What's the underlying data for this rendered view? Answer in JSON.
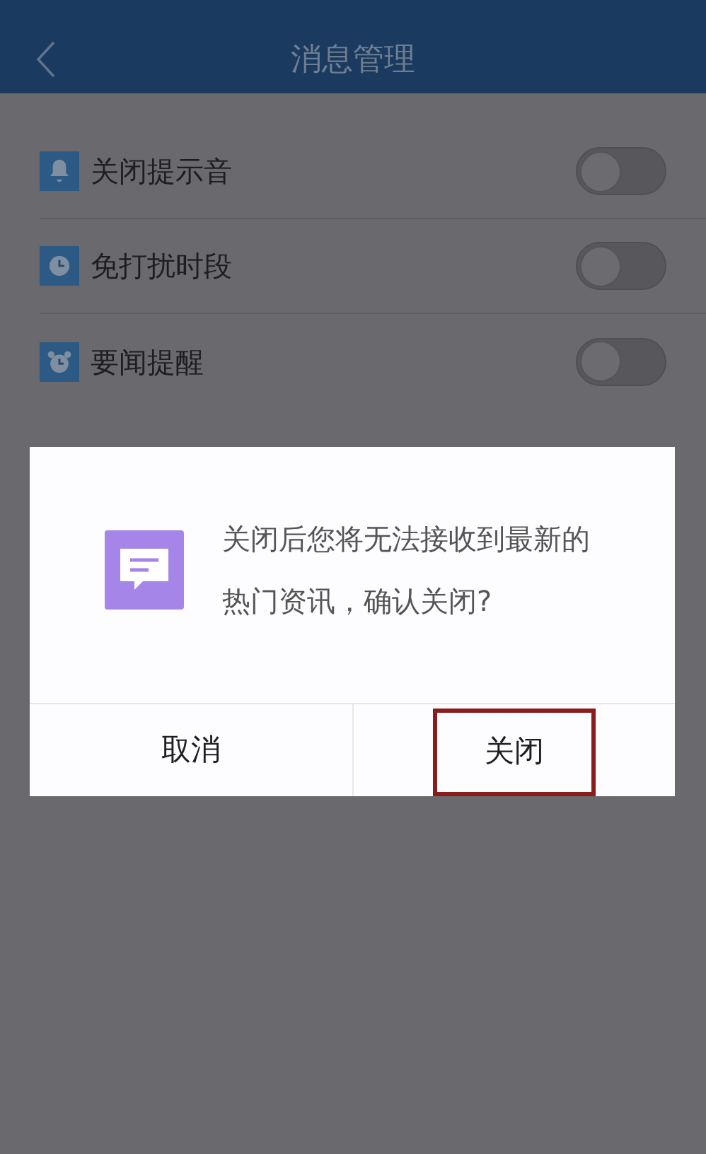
{
  "header": {
    "title": "消息管理"
  },
  "settings": [
    {
      "kind": "bell",
      "label": "关闭提示音",
      "on": false
    },
    {
      "kind": "clock",
      "label": "免打扰时段",
      "on": false
    },
    {
      "kind": "alarm",
      "label": "要闻提醒",
      "on": false
    }
  ],
  "dialog": {
    "message": "关闭后您将无法接收到最新的热门资讯，确认关闭?",
    "buttons": [
      {
        "label": "取消",
        "highlighted": false
      },
      {
        "label": "关闭",
        "highlighted": true
      }
    ]
  }
}
